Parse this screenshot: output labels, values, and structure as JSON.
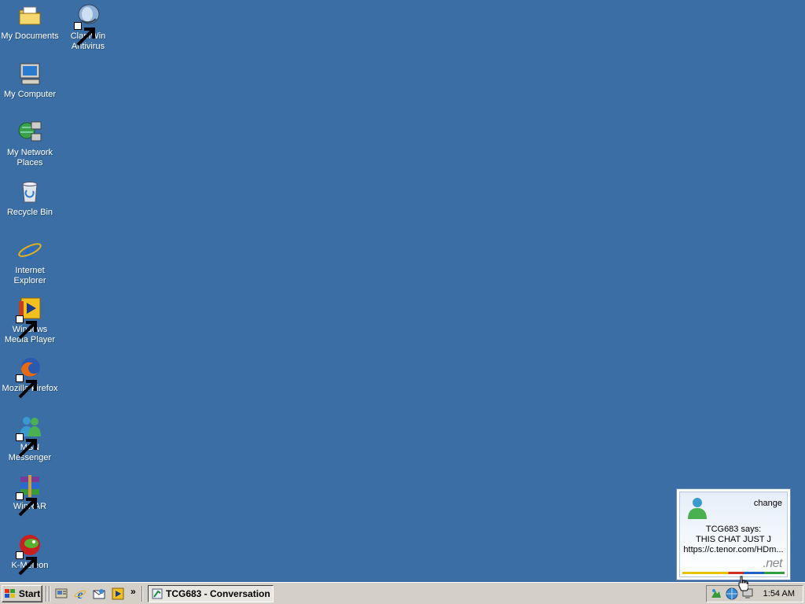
{
  "desktop": {
    "icons": [
      {
        "label": "My Documents",
        "icon": "folder-documents-icon"
      },
      {
        "label": "ClamWin Antivirus",
        "icon": "clamwin-icon",
        "shortcut": true
      },
      {
        "label": "My Computer",
        "icon": "computer-icon"
      },
      {
        "label": "My Network Places",
        "icon": "network-icon"
      },
      {
        "label": "Recycle Bin",
        "icon": "recycle-bin-icon"
      },
      {
        "label": "Internet Explorer",
        "icon": "internet-explorer-icon"
      },
      {
        "label": "Windows Media Player",
        "icon": "media-player-icon",
        "shortcut": true
      },
      {
        "label": "Mozilla Firefox",
        "icon": "firefox-icon",
        "shortcut": true
      },
      {
        "label": "MSN Messenger",
        "icon": "msn-messenger-icon",
        "shortcut": true
      },
      {
        "label": "WinRAR",
        "icon": "winrar-icon",
        "shortcut": true
      },
      {
        "label": "K-Meleon",
        "icon": "k-meleon-icon",
        "shortcut": true
      }
    ],
    "background_color": "#3a6ea5"
  },
  "notification": {
    "change_label": "change",
    "line1": "TCG683 says:",
    "line2": "THIS CHAT JUST J",
    "line3": "https://c.tenor.com/HDm...",
    "brand": ".net"
  },
  "taskbar": {
    "start_label": "Start",
    "chevron": "»",
    "task_label": "TCG683 - Conversation",
    "clock": "1:54 AM"
  }
}
